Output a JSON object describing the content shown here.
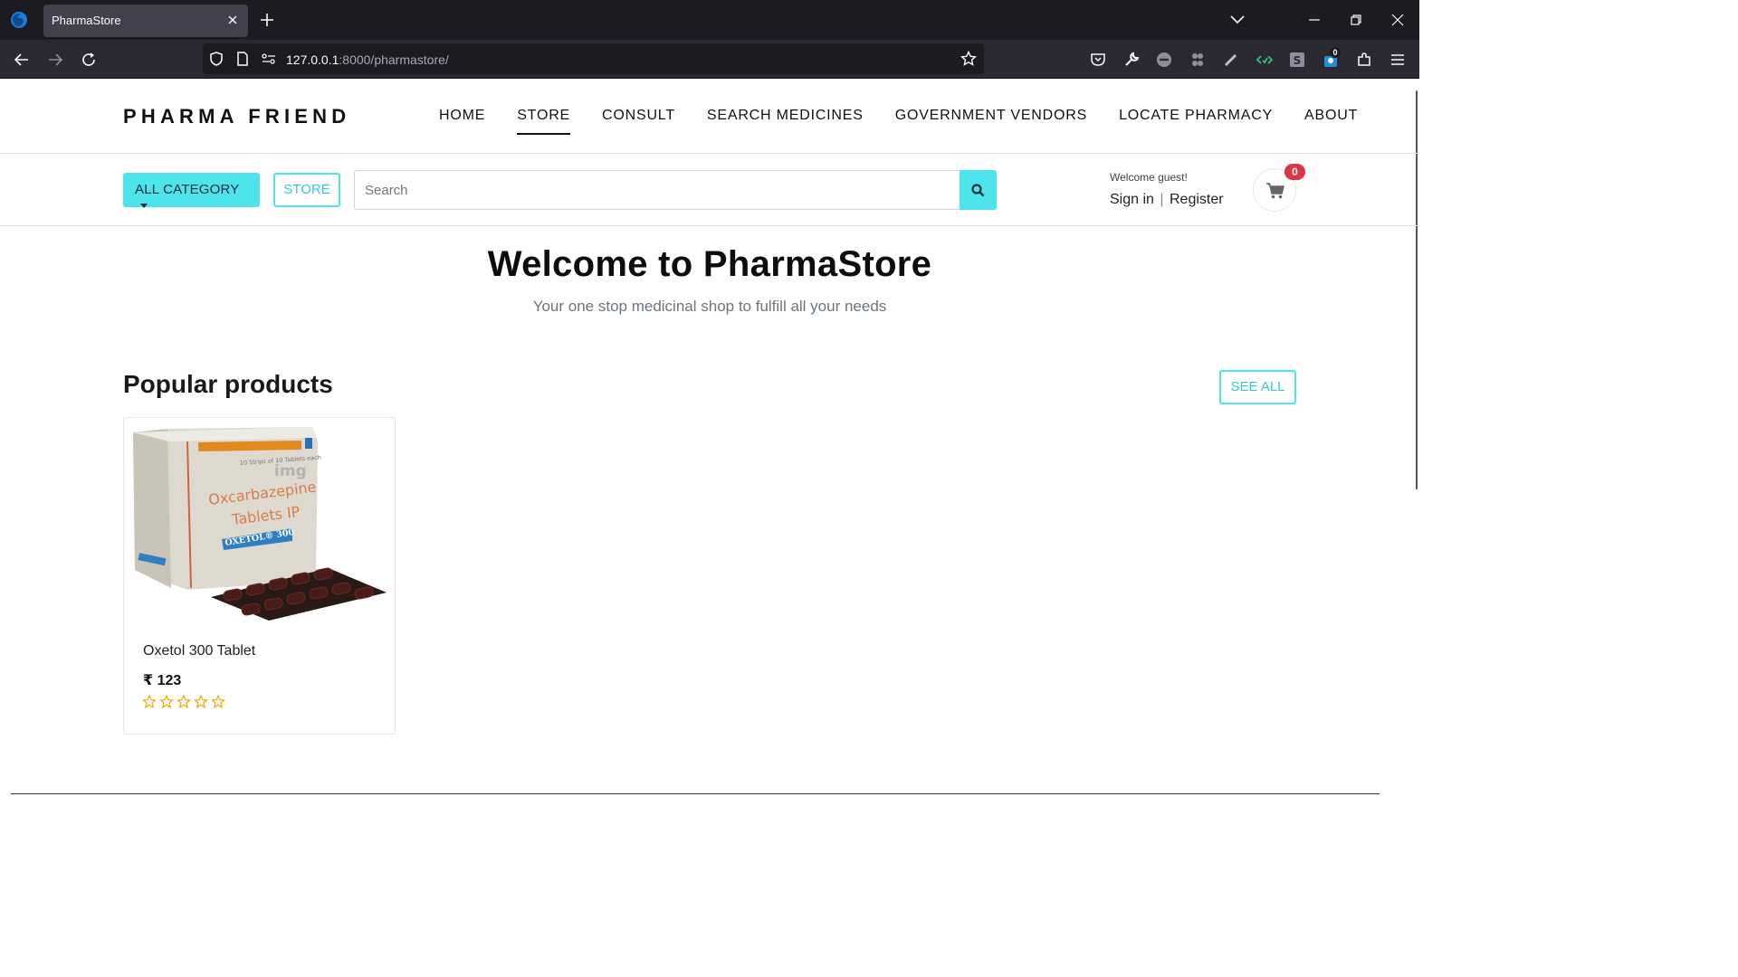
{
  "browser": {
    "tab_title": "PharmaStore",
    "url_host": "127.0.0.1",
    "url_rest": ":8000/pharmastore/",
    "extension_badge": "0"
  },
  "site": {
    "brand": "PHARMA FRIEND",
    "nav": [
      {
        "label": "HOME",
        "active": false
      },
      {
        "label": "STORE",
        "active": true
      },
      {
        "label": "CONSULT",
        "active": false
      },
      {
        "label": "SEARCH MEDICINES",
        "active": false
      },
      {
        "label": "GOVERNMENT VENDORS",
        "active": false
      },
      {
        "label": "LOCATE PHARMACY",
        "active": false
      },
      {
        "label": "ABOUT",
        "active": false
      }
    ]
  },
  "toolbar": {
    "category_label": "ALL CATEGORY",
    "store_label": "STORE",
    "search_placeholder": "Search",
    "welcome": "Welcome guest!",
    "sign_in": "Sign in",
    "separator": "|",
    "register": "Register",
    "cart_count": "0"
  },
  "hero": {
    "title": "Welcome to PharmaStore",
    "subtitle": "Your one stop medicinal shop to fulfill all your needs"
  },
  "popular": {
    "title": "Popular products",
    "see_all": "SEE ALL",
    "products": [
      {
        "name": "Oxetol 300 Tablet",
        "price": "₹ 123",
        "rating": 0,
        "box_lines": [
          "10 Strips of 10 Tablets each",
          "Oxcarbazepine",
          "Tablets IP",
          "OXETOL® 300"
        ],
        "watermark": "img"
      }
    ]
  },
  "colors": {
    "accent": "#4de4ec",
    "badge": "#dc3545",
    "star": "#f0a500"
  }
}
